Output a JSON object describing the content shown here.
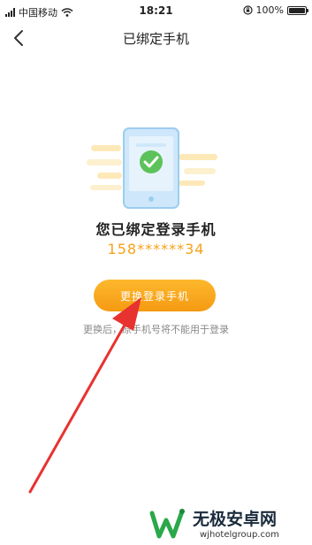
{
  "status_bar": {
    "carrier": "中国移动",
    "time": "18:21",
    "battery_percent": "100%",
    "battery_level": 1.0,
    "icons": [
      "signal-icon",
      "wifi-icon",
      "rotation-lock-icon",
      "battery-icon"
    ]
  },
  "nav": {
    "title": "已绑定手机",
    "back_icon": "back-chevron-icon"
  },
  "main": {
    "bound_title": "您已绑定登录手机",
    "phone_number": "158******34",
    "change_button_label": "更换登录手机",
    "hint": "更换后，原手机号将不能用于登录",
    "illustration": "phone-check-illustration"
  },
  "colors": {
    "accent": "#f5a21b",
    "button_top": "#fdb82d",
    "button_bottom": "#f59a12",
    "phone_body": "#cfe7fb",
    "check_green": "#5cc25a",
    "arrow_red": "#e8322f"
  },
  "watermark": {
    "name": "无极安卓网",
    "url": "wjhotelgroup.com"
  }
}
